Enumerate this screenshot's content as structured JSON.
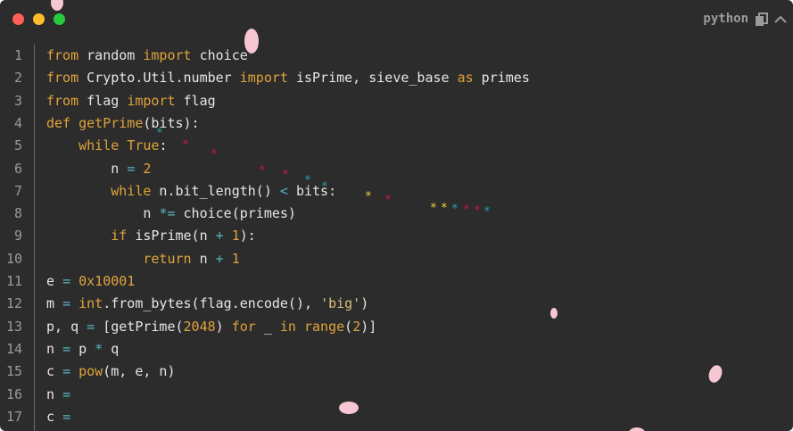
{
  "window": {
    "language_label": "python",
    "traffic_lights": [
      "#ff5f56",
      "#ffbd2e",
      "#27c93f"
    ]
  },
  "code": {
    "lines": [
      {
        "n": "1",
        "tokens": [
          [
            "kw",
            "from"
          ],
          [
            "t",
            " random "
          ],
          [
            "kw",
            "import"
          ],
          [
            "t",
            " choice"
          ]
        ]
      },
      {
        "n": "2",
        "tokens": [
          [
            "kw",
            "from"
          ],
          [
            "t",
            " Crypto.Util.number "
          ],
          [
            "kw",
            "import"
          ],
          [
            "t",
            " isPrime, sieve_base "
          ],
          [
            "kw",
            "as"
          ],
          [
            "t",
            " primes"
          ]
        ]
      },
      {
        "n": "3",
        "tokens": [
          [
            "kw",
            "from"
          ],
          [
            "t",
            " flag "
          ],
          [
            "kw",
            "import"
          ],
          [
            "t",
            " flag"
          ]
        ]
      },
      {
        "n": "4",
        "tokens": [
          [
            "kw",
            "def"
          ],
          [
            "t",
            " "
          ],
          [
            "fn",
            "getPrime"
          ],
          [
            "t",
            "(bits):"
          ]
        ]
      },
      {
        "n": "5",
        "tokens": [
          [
            "t",
            "    "
          ],
          [
            "kw",
            "while"
          ],
          [
            "t",
            " "
          ],
          [
            "kw",
            "True"
          ],
          [
            "t",
            ":"
          ]
        ]
      },
      {
        "n": "6",
        "tokens": [
          [
            "t",
            "        n "
          ],
          [
            "op",
            "="
          ],
          [
            "t",
            " "
          ],
          [
            "num",
            "2"
          ]
        ]
      },
      {
        "n": "7",
        "tokens": [
          [
            "t",
            "        "
          ],
          [
            "kw",
            "while"
          ],
          [
            "t",
            " n.bit_length() "
          ],
          [
            "op",
            "<"
          ],
          [
            "t",
            " bits:"
          ]
        ]
      },
      {
        "n": "8",
        "tokens": [
          [
            "t",
            "            n "
          ],
          [
            "op",
            "*="
          ],
          [
            "t",
            " choice(primes)"
          ]
        ]
      },
      {
        "n": "9",
        "tokens": [
          [
            "t",
            "        "
          ],
          [
            "kw",
            "if"
          ],
          [
            "t",
            " isPrime(n "
          ],
          [
            "op",
            "+"
          ],
          [
            "t",
            " "
          ],
          [
            "num",
            "1"
          ],
          [
            "t",
            "):"
          ]
        ]
      },
      {
        "n": "10",
        "tokens": [
          [
            "t",
            "            "
          ],
          [
            "kw",
            "return"
          ],
          [
            "t",
            " n "
          ],
          [
            "op",
            "+"
          ],
          [
            "t",
            " "
          ],
          [
            "num",
            "1"
          ]
        ]
      },
      {
        "n": "11",
        "tokens": [
          [
            "t",
            "e "
          ],
          [
            "op",
            "="
          ],
          [
            "t",
            " "
          ],
          [
            "num",
            "0x10001"
          ]
        ]
      },
      {
        "n": "12",
        "tokens": [
          [
            "t",
            "m "
          ],
          [
            "op",
            "="
          ],
          [
            "t",
            " "
          ],
          [
            "fn",
            "int"
          ],
          [
            "t",
            ".from_bytes(flag.encode(), "
          ],
          [
            "str",
            "'big'"
          ],
          [
            "t",
            ")"
          ]
        ]
      },
      {
        "n": "13",
        "tokens": [
          [
            "t",
            "p, q "
          ],
          [
            "op",
            "="
          ],
          [
            "t",
            " [getPrime("
          ],
          [
            "num",
            "2048"
          ],
          [
            "t",
            ") "
          ],
          [
            "kw",
            "for"
          ],
          [
            "t",
            " _ "
          ],
          [
            "kw",
            "in"
          ],
          [
            "t",
            " "
          ],
          [
            "fn",
            "range"
          ],
          [
            "t",
            "("
          ],
          [
            "num",
            "2"
          ],
          [
            "t",
            ")]"
          ]
        ]
      },
      {
        "n": "14",
        "tokens": [
          [
            "t",
            "n "
          ],
          [
            "op",
            "="
          ],
          [
            "t",
            " p "
          ],
          [
            "op",
            "*"
          ],
          [
            "t",
            " q"
          ]
        ]
      },
      {
        "n": "15",
        "tokens": [
          [
            "t",
            "c "
          ],
          [
            "op",
            "="
          ],
          [
            "t",
            " "
          ],
          [
            "fn",
            "pow"
          ],
          [
            "t",
            "(m, e, n)"
          ]
        ]
      },
      {
        "n": "16",
        "tokens": [
          [
            "t",
            "n "
          ],
          [
            "op",
            "="
          ]
        ]
      },
      {
        "n": "17",
        "tokens": [
          [
            "t",
            "c "
          ],
          [
            "op",
            "="
          ]
        ]
      }
    ]
  },
  "decorations": {
    "petal_color": "#f7c6d3",
    "stars": [
      {
        "c": "#c2185b"
      },
      {
        "c": "#26a0a8"
      },
      {
        "c": "#c2185b"
      },
      {
        "c": "#c2185b"
      },
      {
        "c": "#c2185b"
      },
      {
        "c": "#26a0a8"
      },
      {
        "c": "#26a0a8"
      },
      {
        "c": "#f2d13c"
      },
      {
        "c": "#c2185b"
      },
      {
        "c": "#f2d13c"
      },
      {
        "c": "#f2d13c"
      },
      {
        "c": "#26a0a8"
      },
      {
        "c": "#c2185b"
      },
      {
        "c": "#c2185b"
      },
      {
        "c": "#26a0a8"
      }
    ]
  }
}
